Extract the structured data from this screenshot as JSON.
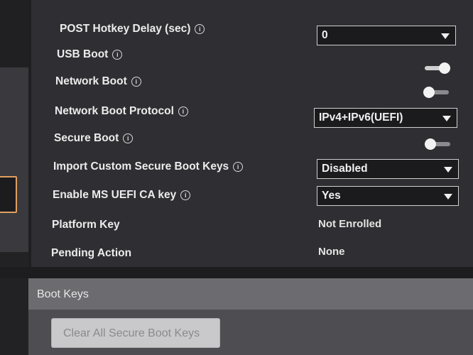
{
  "settings": {
    "post_hotkey_delay": {
      "label": "POST Hotkey Delay (sec)",
      "value": "0"
    },
    "usb_boot": {
      "label": "USB Boot",
      "state": "on"
    },
    "network_boot": {
      "label": "Network Boot",
      "state": "off"
    },
    "network_boot_protocol": {
      "label": "Network Boot Protocol",
      "value": "IPv4+IPv6(UEFI)"
    },
    "secure_boot": {
      "label": "Secure Boot",
      "state": "off"
    },
    "import_custom_keys": {
      "label": "Import Custom Secure Boot Keys",
      "value": "Disabled"
    },
    "ms_uefi_ca_key": {
      "label": "Enable MS UEFI CA key",
      "value": "Yes"
    },
    "platform_key": {
      "label": "Platform Key",
      "value": "Not Enrolled"
    },
    "pending_action": {
      "label": "Pending Action",
      "value": "None"
    }
  },
  "boot_keys": {
    "title": "Boot Keys",
    "clear_button_label": "Clear All Secure Boot Keys"
  },
  "icons": {
    "info": "info-icon",
    "dropdown": "chevron-down-icon",
    "info_glyph": "i"
  },
  "colors": {
    "panel_bg": "#2f2f33",
    "section_header_bg": "#6c6c70",
    "focus_accent": "#e0a060"
  }
}
